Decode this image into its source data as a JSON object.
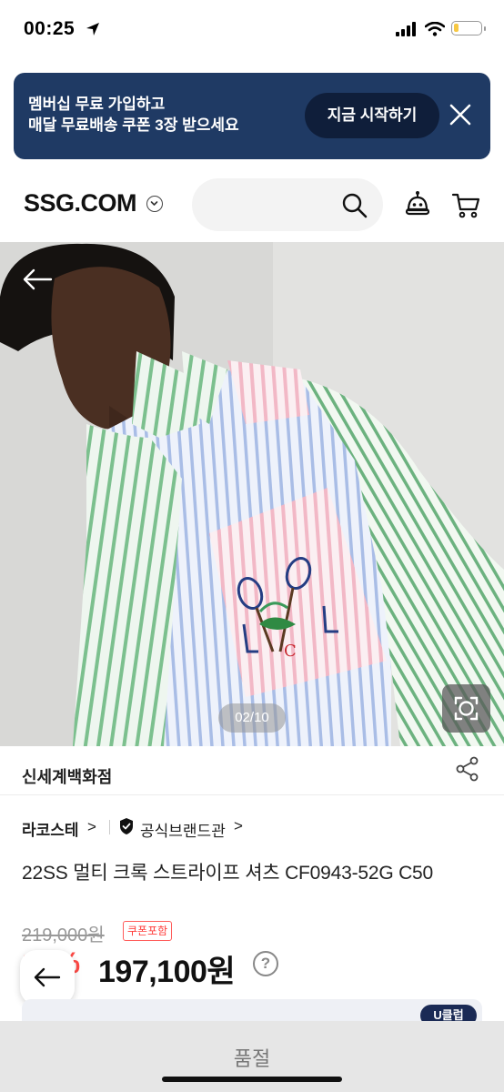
{
  "status_bar": {
    "time": "00:25",
    "battery_level": 0.2,
    "battery_color": "#f7c843"
  },
  "banner": {
    "line1": "멤버십 무료 가입하고",
    "line2": "매달 무료배송 쿠폰 3장 받으세요",
    "button_label": "지금 시작하기",
    "bg_color": "#1f3a64"
  },
  "header": {
    "logo": "SSG.COM",
    "search_placeholder": ""
  },
  "gallery": {
    "counter": "02/10"
  },
  "store": {
    "name": "신세계백화점"
  },
  "brand": {
    "name": "라코스테",
    "chevron": ">",
    "official_label": "공식브랜드관",
    "official_chevron": ">"
  },
  "product": {
    "title": "22SS 멀티 크록 스트라이프 셔츠 CF0943-52G C50",
    "original_price": "219,000원",
    "coupon_badge": "쿠폰포함",
    "discount": "10%",
    "price": "197,100원",
    "help": "?"
  },
  "card_peek": {
    "badge": "U클럽"
  },
  "bottom_bar": {
    "label": "품절"
  },
  "colors": {
    "accent_red": "#ff4a46",
    "navy": "#1f3a64"
  }
}
